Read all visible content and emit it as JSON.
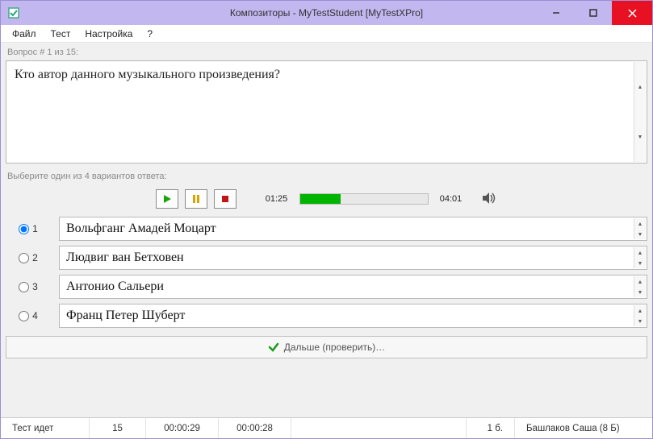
{
  "window": {
    "title": "Композиторы - MyTestStudent [MyTestXPro]"
  },
  "menu": {
    "file": "Файл",
    "test": "Тест",
    "settings": "Настройка",
    "help": "?"
  },
  "question_counter": "Вопрос # 1 из 15:",
  "question_text": "Кто автор данного музыкального произведения?",
  "answers_hint": "Выберите один из 4 вариантов ответа:",
  "media": {
    "current": "01:25",
    "total": "04:01",
    "progress_pct": 32
  },
  "answers": [
    {
      "num": "1",
      "text": "Вольфганг Амадей Моцарт",
      "selected": true
    },
    {
      "num": "2",
      "text": "Людвиг ван Бетховен",
      "selected": false
    },
    {
      "num": "3",
      "text": "Антонио Сальери",
      "selected": false
    },
    {
      "num": "4",
      "text": "Франц Петер Шуберт",
      "selected": false
    }
  ],
  "next_label": "Дальше (проверить)…",
  "status": {
    "state": "Тест идет",
    "total_q": "15",
    "elapsed": "00:00:29",
    "remaining": "00:00:28",
    "score": "1 б.",
    "user": "Башлаков Саша (8 Б)"
  }
}
